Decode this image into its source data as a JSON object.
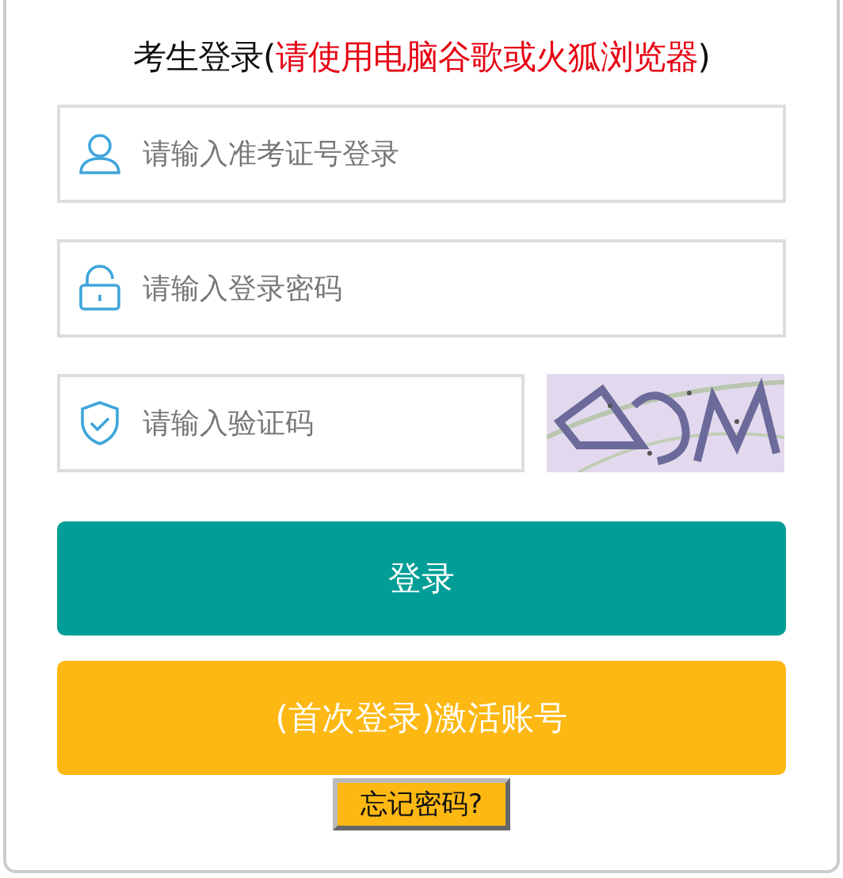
{
  "title": {
    "lead": "考生登录(",
    "note": "请使用电脑谷歌或火狐浏览器",
    "tail": ")"
  },
  "fields": [
    {
      "kind": "user",
      "placeholder": "请输入准考证号登录"
    },
    {
      "kind": "lock",
      "placeholder": "请输入登录密码"
    },
    {
      "kind": "shield",
      "placeholder": "请输入验证码"
    }
  ],
  "buttons": [
    {
      "kind": "primary",
      "label": "登录"
    },
    {
      "kind": "activate",
      "label": "(首次登录)激活账号"
    }
  ],
  "forgot": {
    "label": "忘记密码?"
  }
}
